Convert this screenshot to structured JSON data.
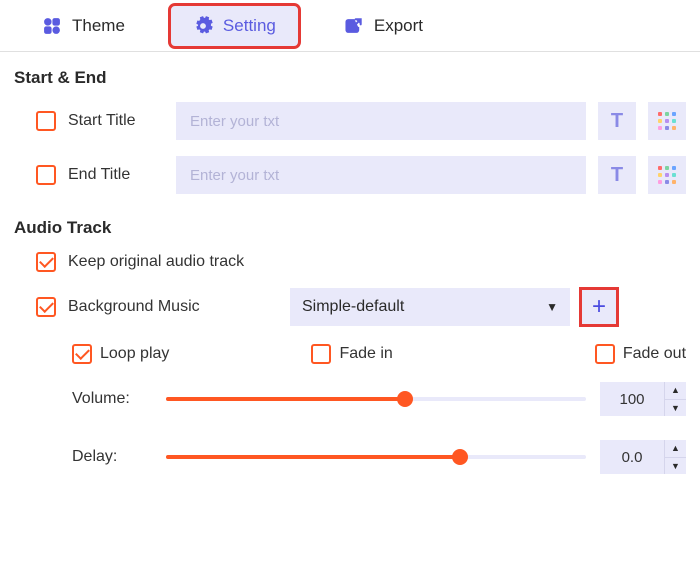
{
  "tabs": {
    "theme": "Theme",
    "setting": "Setting",
    "export": "Export"
  },
  "sections": {
    "start_end": "Start & End",
    "audio_track": "Audio Track"
  },
  "start_end": {
    "start_title_label": "Start Title",
    "end_title_label": "End Title",
    "placeholder": "Enter your txt",
    "start_value": "",
    "end_value": "",
    "start_checked": false,
    "end_checked": false
  },
  "audio": {
    "keep_original_label": "Keep original audio track",
    "keep_original_checked": true,
    "bgm_label": "Background Music",
    "bgm_checked": true,
    "bgm_selected": "Simple-default",
    "loop_label": "Loop play",
    "loop_checked": true,
    "fadein_label": "Fade in",
    "fadein_checked": false,
    "fadeout_label": "Fade out",
    "fadeout_checked": false,
    "volume_label": "Volume:",
    "volume_value": "100",
    "volume_pct": 57,
    "delay_label": "Delay:",
    "delay_value": "0.0",
    "delay_pct": 70
  },
  "icons": {
    "text_btn": "T"
  }
}
